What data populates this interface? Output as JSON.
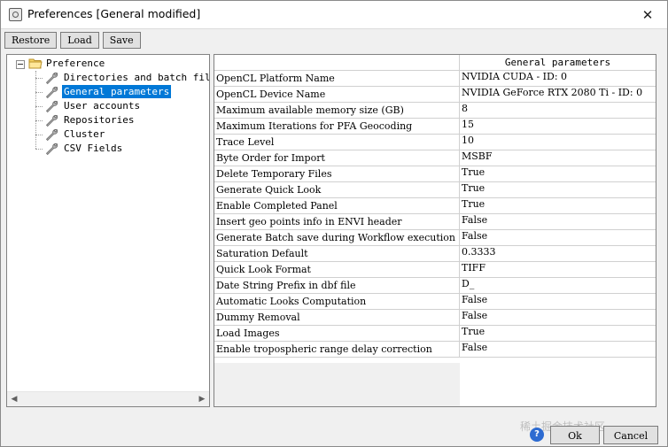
{
  "window": {
    "title": "Preferences [General modified]",
    "close_glyph": "✕"
  },
  "toolbar": {
    "buttons": [
      "Restore",
      "Load",
      "Save"
    ]
  },
  "tree": {
    "root": "Preference",
    "items": [
      {
        "label": "Directories and batch file m",
        "selected": false
      },
      {
        "label": "General parameters",
        "selected": true
      },
      {
        "label": "User accounts",
        "selected": false
      },
      {
        "label": "Repositories",
        "selected": false
      },
      {
        "label": "Cluster",
        "selected": false
      },
      {
        "label": "CSV Fields",
        "selected": false
      }
    ]
  },
  "grid": {
    "header": "General parameters",
    "rows": [
      {
        "key": "OpenCL Platform Name",
        "value": "NVIDIA CUDA - ID: 0"
      },
      {
        "key": "OpenCL Device Name",
        "value": "NVIDIA GeForce RTX 2080 Ti - ID: 0"
      },
      {
        "key": "Maximum available memory size (GB)",
        "value": "8"
      },
      {
        "key": "Maximum Iterations for PFA Geocoding",
        "value": "15"
      },
      {
        "key": "Trace Level",
        "value": "10"
      },
      {
        "key": "Byte Order for Import",
        "value": "MSBF"
      },
      {
        "key": "Delete Temporary Files",
        "value": "True"
      },
      {
        "key": "Generate Quick Look",
        "value": "True"
      },
      {
        "key": "Enable Completed Panel",
        "value": "True"
      },
      {
        "key": "Insert geo points info in ENVI header",
        "value": "False"
      },
      {
        "key": "Generate Batch save during Workflow execution",
        "value": "False"
      },
      {
        "key": "Saturation Default",
        "value": "0.3333"
      },
      {
        "key": "Quick Look Format",
        "value": "TIFF"
      },
      {
        "key": "Date String Prefix in dbf file",
        "value": "D_"
      },
      {
        "key": "Automatic Looks Computation",
        "value": "False"
      },
      {
        "key": "Dummy Removal",
        "value": "False"
      },
      {
        "key": "Load Images",
        "value": "True"
      },
      {
        "key": "Enable tropospheric range delay correction",
        "value": "False"
      }
    ]
  },
  "footer": {
    "help_glyph": "?",
    "ok_label": "Ok",
    "cancel_label": "Cancel",
    "watermark": "稀土掘金技术社区"
  },
  "colors": {
    "selection": "#0078d7",
    "help": "#2d6bd1",
    "panel_border": "#828282"
  }
}
